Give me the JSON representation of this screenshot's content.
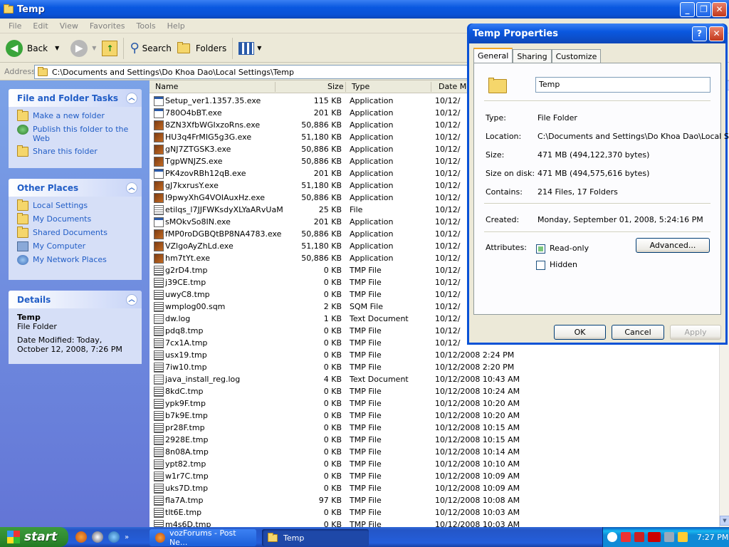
{
  "window": {
    "title": "Temp"
  },
  "menu": [
    "File",
    "Edit",
    "View",
    "Favorites",
    "Tools",
    "Help"
  ],
  "toolbar": {
    "back": "Back",
    "search": "Search",
    "folders": "Folders"
  },
  "address": {
    "label": "Address",
    "path": "C:\\Documents and Settings\\Do Khoa Dao\\Local Settings\\Temp"
  },
  "tasks": {
    "title": "File and Folder Tasks",
    "items": [
      "Make a new folder",
      "Publish this folder to the Web",
      "Share this folder"
    ]
  },
  "places": {
    "title": "Other Places",
    "items": [
      "Local Settings",
      "My Documents",
      "Shared Documents",
      "My Computer",
      "My Network Places"
    ]
  },
  "details": {
    "title": "Details",
    "name": "Temp",
    "type": "File Folder",
    "modified": "Date Modified: Today, October 12, 2008, 7:26 PM"
  },
  "columns": {
    "name": "Name",
    "size": "Size",
    "type": "Type",
    "date": "Date Mo"
  },
  "files": [
    {
      "name": "Setup_ver1.1357.35.exe",
      "size": "115 KB",
      "type": "Application",
      "date": "10/12/",
      "icon": "app"
    },
    {
      "name": "780O4bBT.exe",
      "size": "201 KB",
      "type": "Application",
      "date": "10/12/",
      "icon": "app"
    },
    {
      "name": "8ZN3XfbWGIxzoRns.exe",
      "size": "50,886 KB",
      "type": "Application",
      "date": "10/12/",
      "icon": "img"
    },
    {
      "name": "HU3q4FrMIG5g3G.exe",
      "size": "51,180 KB",
      "type": "Application",
      "date": "10/12/",
      "icon": "img"
    },
    {
      "name": "gNJ7ZTGSK3.exe",
      "size": "50,886 KB",
      "type": "Application",
      "date": "10/12/",
      "icon": "img"
    },
    {
      "name": "TgpWNJZS.exe",
      "size": "50,886 KB",
      "type": "Application",
      "date": "10/12/",
      "icon": "img"
    },
    {
      "name": "PK4zovRBh12qB.exe",
      "size": "201 KB",
      "type": "Application",
      "date": "10/12/",
      "icon": "app"
    },
    {
      "name": "gJ7kxrusY.exe",
      "size": "51,180 KB",
      "type": "Application",
      "date": "10/12/",
      "icon": "img"
    },
    {
      "name": "I9pwyXhG4VOIAuxHz.exe",
      "size": "50,886 KB",
      "type": "Application",
      "date": "10/12/",
      "icon": "img"
    },
    {
      "name": "etilqs_l7JJFWKsdyXLYaARvUaM",
      "size": "25 KB",
      "type": "File",
      "date": "10/12/",
      "icon": "txt"
    },
    {
      "name": "sMOkvSo8IN.exe",
      "size": "201 KB",
      "type": "Application",
      "date": "10/12/",
      "icon": "app"
    },
    {
      "name": "fMP0roDGBQtBP8NA4783.exe",
      "size": "50,886 KB",
      "type": "Application",
      "date": "10/12/",
      "icon": "img"
    },
    {
      "name": "VZlgoAyZhLd.exe",
      "size": "51,180 KB",
      "type": "Application",
      "date": "10/12/",
      "icon": "img"
    },
    {
      "name": "hm7tYt.exe",
      "size": "50,886 KB",
      "type": "Application",
      "date": "10/12/",
      "icon": "img"
    },
    {
      "name": "g2rD4.tmp",
      "size": "0 KB",
      "type": "TMP File",
      "date": "10/12/",
      "icon": "tmp"
    },
    {
      "name": "j39CE.tmp",
      "size": "0 KB",
      "type": "TMP File",
      "date": "10/12/",
      "icon": "tmp"
    },
    {
      "name": "uwyC8.tmp",
      "size": "0 KB",
      "type": "TMP File",
      "date": "10/12/",
      "icon": "tmp"
    },
    {
      "name": "wmplog00.sqm",
      "size": "2 KB",
      "type": "SQM File",
      "date": "10/12/",
      "icon": "tmp"
    },
    {
      "name": "dw.log",
      "size": "1 KB",
      "type": "Text Document",
      "date": "10/12/",
      "icon": "txt"
    },
    {
      "name": "pdq8.tmp",
      "size": "0 KB",
      "type": "TMP File",
      "date": "10/12/",
      "icon": "tmp"
    },
    {
      "name": "7cx1A.tmp",
      "size": "0 KB",
      "type": "TMP File",
      "date": "10/12/",
      "icon": "tmp"
    },
    {
      "name": "usx19.tmp",
      "size": "0 KB",
      "type": "TMP File",
      "date": "10/12/2008 2:24 PM",
      "icon": "tmp"
    },
    {
      "name": "7iw10.tmp",
      "size": "0 KB",
      "type": "TMP File",
      "date": "10/12/2008 2:20 PM",
      "icon": "tmp"
    },
    {
      "name": "java_install_reg.log",
      "size": "4 KB",
      "type": "Text Document",
      "date": "10/12/2008 10:43 AM",
      "icon": "txt"
    },
    {
      "name": "8kdC.tmp",
      "size": "0 KB",
      "type": "TMP File",
      "date": "10/12/2008 10:24 AM",
      "icon": "tmp"
    },
    {
      "name": "ypk9F.tmp",
      "size": "0 KB",
      "type": "TMP File",
      "date": "10/12/2008 10:20 AM",
      "icon": "tmp"
    },
    {
      "name": "b7k9E.tmp",
      "size": "0 KB",
      "type": "TMP File",
      "date": "10/12/2008 10:20 AM",
      "icon": "tmp"
    },
    {
      "name": "pr28F.tmp",
      "size": "0 KB",
      "type": "TMP File",
      "date": "10/12/2008 10:15 AM",
      "icon": "tmp"
    },
    {
      "name": "2928E.tmp",
      "size": "0 KB",
      "type": "TMP File",
      "date": "10/12/2008 10:15 AM",
      "icon": "tmp"
    },
    {
      "name": "8n08A.tmp",
      "size": "0 KB",
      "type": "TMP File",
      "date": "10/12/2008 10:14 AM",
      "icon": "tmp"
    },
    {
      "name": "ypt82.tmp",
      "size": "0 KB",
      "type": "TMP File",
      "date": "10/12/2008 10:10 AM",
      "icon": "tmp"
    },
    {
      "name": "w1r7C.tmp",
      "size": "0 KB",
      "type": "TMP File",
      "date": "10/12/2008 10:09 AM",
      "icon": "tmp"
    },
    {
      "name": "uks7D.tmp",
      "size": "0 KB",
      "type": "TMP File",
      "date": "10/12/2008 10:09 AM",
      "icon": "tmp"
    },
    {
      "name": "fla7A.tmp",
      "size": "97 KB",
      "type": "TMP File",
      "date": "10/12/2008 10:08 AM",
      "icon": "tmp"
    },
    {
      "name": "tlt6E.tmp",
      "size": "0 KB",
      "type": "TMP File",
      "date": "10/12/2008 10:03 AM",
      "icon": "tmp"
    },
    {
      "name": "m4s6D.tmp",
      "size": "0 KB",
      "type": "TMP File",
      "date": "10/12/2008 10:03 AM",
      "icon": "tmp"
    }
  ],
  "dialog": {
    "title": "Temp Properties",
    "tabs": [
      "General",
      "Sharing",
      "Customize"
    ],
    "name_value": "Temp",
    "type_label": "Type:",
    "type_value": "File Folder",
    "location_label": "Location:",
    "location_value": "C:\\Documents and Settings\\Do Khoa Dao\\Local Se",
    "size_label": "Size:",
    "size_value": "471 MB (494,122,370 bytes)",
    "disk_label": "Size on disk:",
    "disk_value": "471 MB (494,575,616 bytes)",
    "contains_label": "Contains:",
    "contains_value": "214 Files, 17 Folders",
    "created_label": "Created:",
    "created_value": "Monday, September 01, 2008, 5:24:16 PM",
    "attributes_label": "Attributes:",
    "readonly_label": "Read-only",
    "hidden_label": "Hidden",
    "advanced": "Advanced...",
    "ok": "OK",
    "cancel": "Cancel",
    "apply": "Apply"
  },
  "taskbar": {
    "start": "start",
    "task1": "vozForums - Post Ne...",
    "task2": "Temp",
    "clock": "7:27 PM"
  }
}
